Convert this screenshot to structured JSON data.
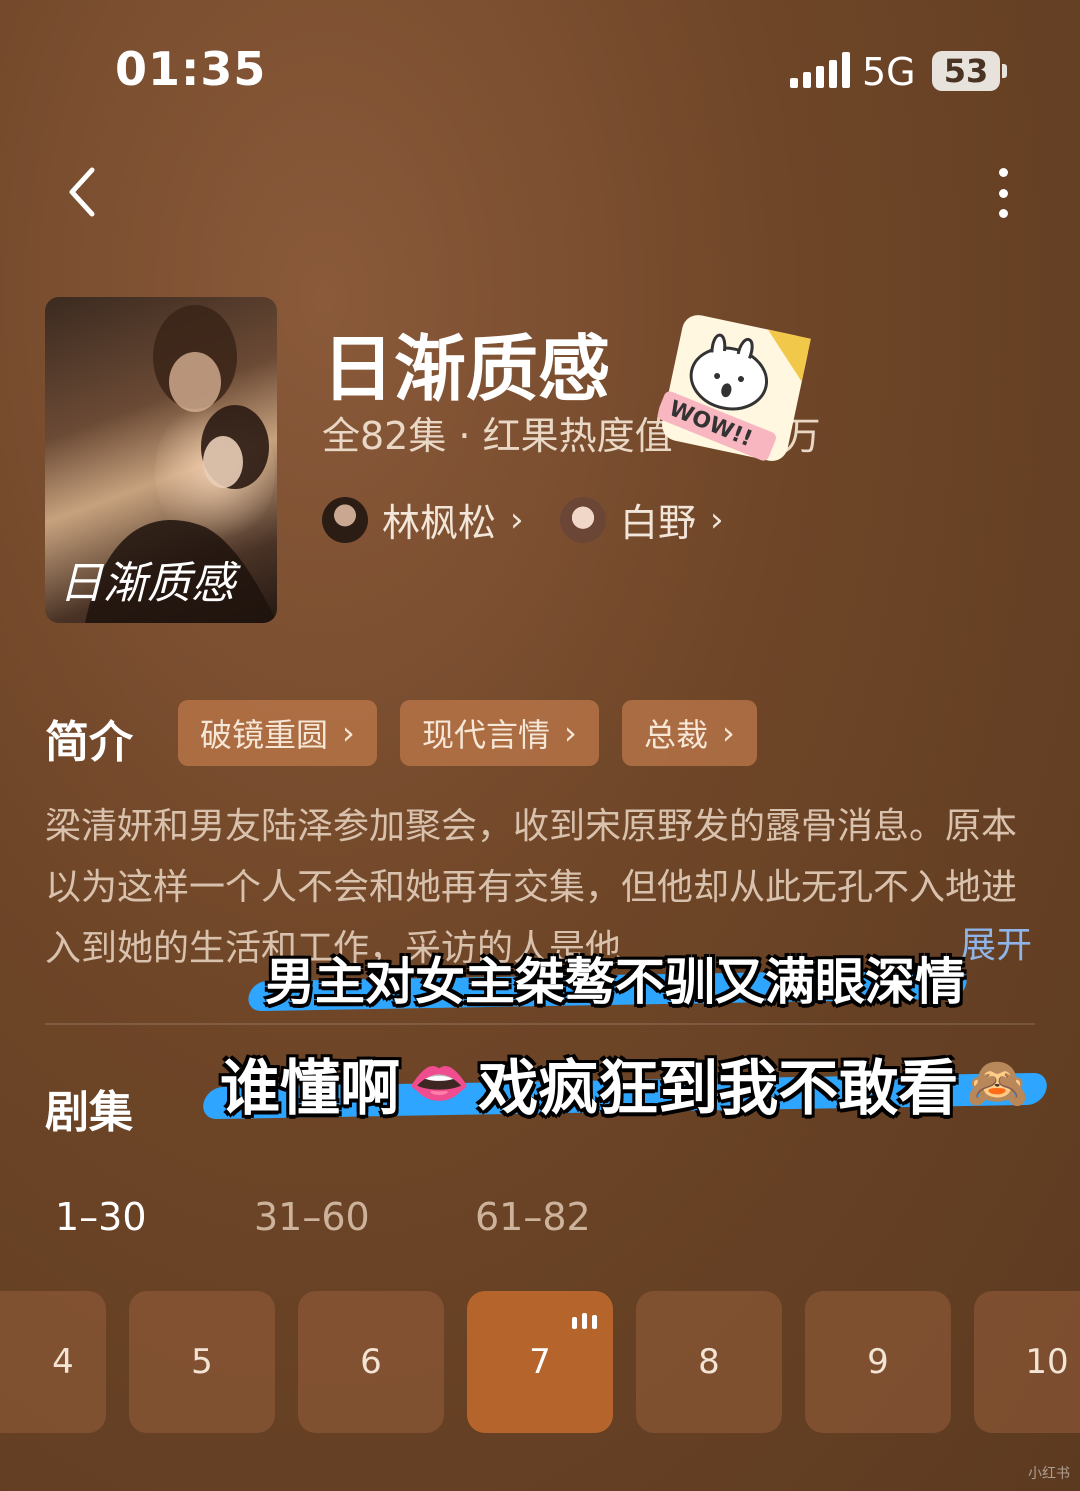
{
  "status_bar": {
    "time": "01:35",
    "network": "5G",
    "battery": "53"
  },
  "show": {
    "title": "日渐质感",
    "meta": "全82集 · 红果热度值",
    "meta_tail": "万",
    "poster_title": "日渐质感",
    "sticker_text": "WOW!!",
    "actors": [
      {
        "name": "林枫松"
      },
      {
        "name": "白野"
      }
    ]
  },
  "intro": {
    "label": "简介",
    "tags": [
      {
        "label": "破镜重圆"
      },
      {
        "label": "现代言情"
      },
      {
        "label": "总裁"
      }
    ],
    "description": "梁清妍和男友陆泽参加聚会，收到宋原野发的露骨消息。原本以为这样一个人不会和她再有交集，但他却从此无孔不入地进入到她的生活和工作，采访的人是他",
    "expand": "展开"
  },
  "captions": {
    "line1": "男主对女主桀骜不驯又满眼深情",
    "line2_a": "谁懂啊",
    "line2_emoji": "👄",
    "line2_b": "戏疯狂到我不敢看",
    "line2_emoji2": "🙈"
  },
  "episodes": {
    "label": "剧集",
    "ranges": [
      {
        "label": "1–30"
      },
      {
        "label": "31–60"
      },
      {
        "label": "61–82"
      }
    ],
    "items": [
      "4",
      "5",
      "6",
      "7",
      "8",
      "9",
      "10"
    ],
    "active": "7"
  },
  "colors": {
    "accent": "#b5642b",
    "link": "#8fb4e8",
    "swoosh": "#2ea6ff"
  },
  "watermark": "小红书"
}
